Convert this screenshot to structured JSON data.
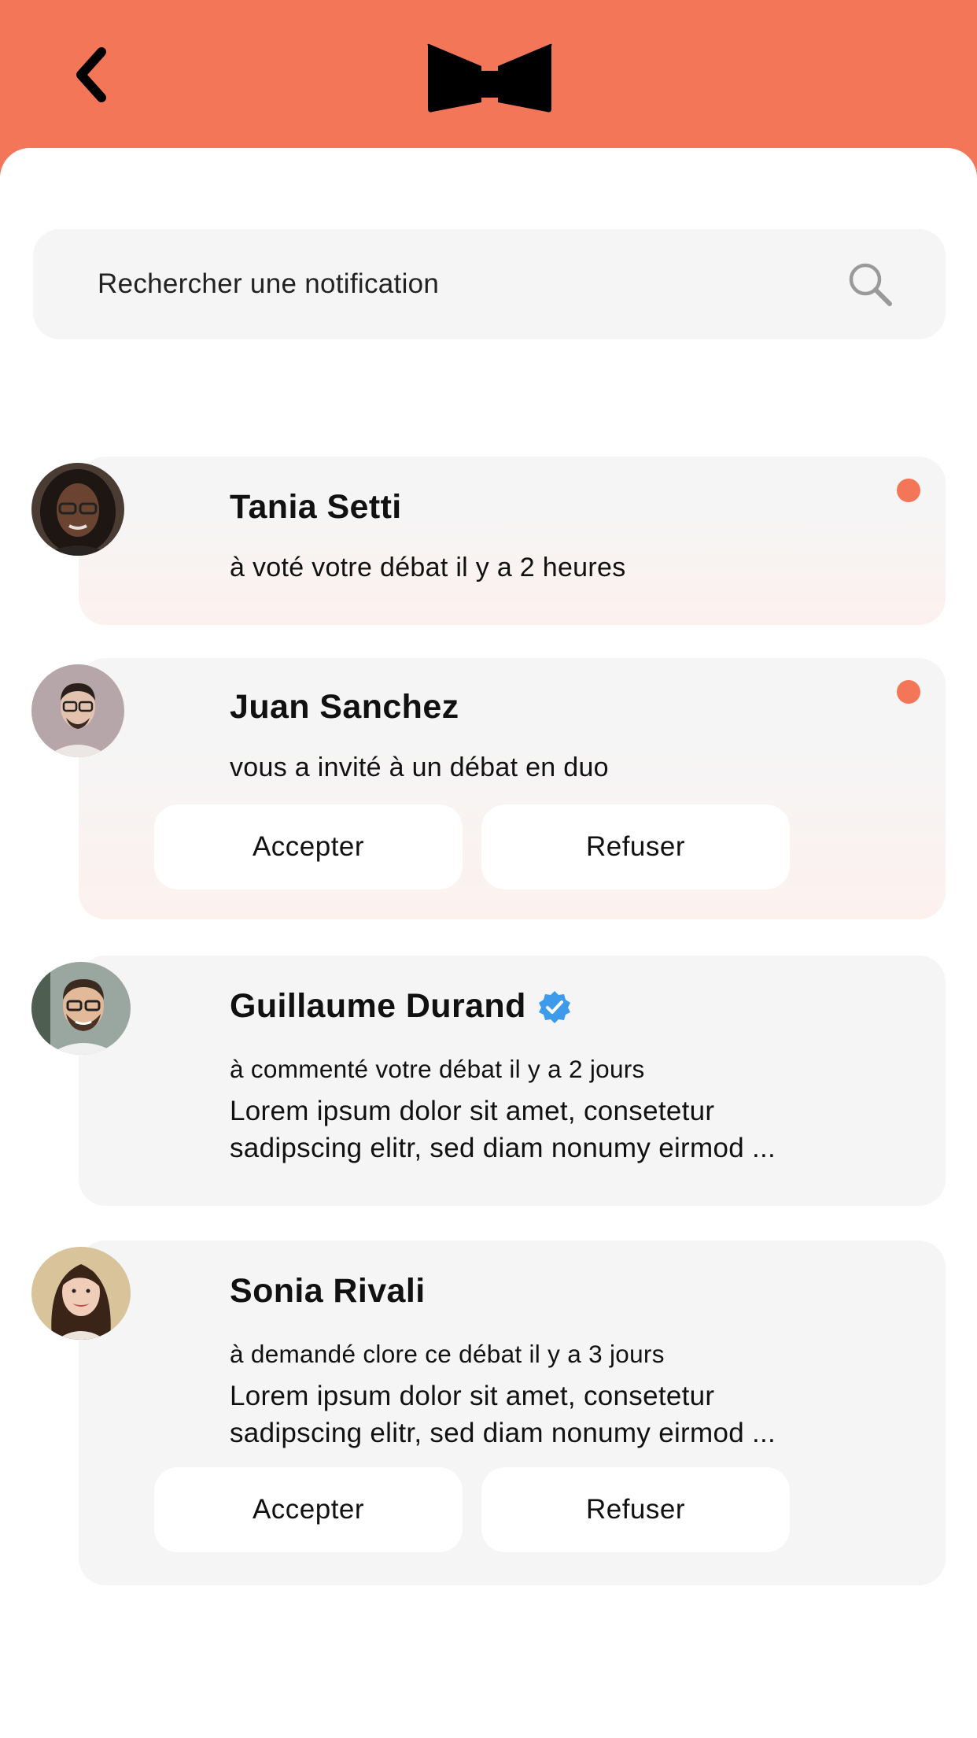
{
  "colors": {
    "accent": "#f27657",
    "card_bg": "#f5f5f5",
    "verified": "#3d9be9"
  },
  "header": {
    "back_icon": "chevron-left-icon",
    "logo_icon": "bow-tie-logo-icon"
  },
  "search": {
    "placeholder": "Rechercher une notification",
    "value": "",
    "icon": "search-icon"
  },
  "notifications": [
    {
      "name": "Tania Setti",
      "message": "à voté votre débat il y a 2 heures",
      "unread": true
    },
    {
      "name": "Juan Sanchez",
      "message": "vous a invité à un débat en duo",
      "unread": true,
      "accept_label": "Accepter",
      "decline_label": "Refuser"
    },
    {
      "name": "Guillaume Durand",
      "verified": true,
      "message": "à commenté votre débat il y a 2 jours",
      "excerpt_line1": "Lorem ipsum dolor sit amet, consetetur",
      "excerpt_line2": "sadipscing elitr, sed diam nonumy eirmod ...",
      "unread": false
    },
    {
      "name": "Sonia Rivali",
      "message": "à demandé clore ce débat il y a 3 jours",
      "excerpt_line1": "Lorem ipsum dolor sit amet, consetetur",
      "excerpt_line2": "sadipscing elitr, sed diam nonumy eirmod ...",
      "unread": false,
      "accept_label": "Accepter",
      "decline_label": "Refuser"
    }
  ]
}
